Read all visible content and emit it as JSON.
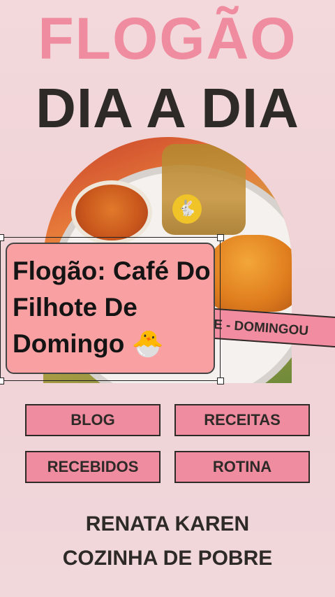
{
  "header": {
    "title_top": "FLOGÃO",
    "title_bottom": "DIA A DIA"
  },
  "photo": {
    "ribbon_text": "E - DOMINGOU",
    "cup_icon": "rabbit-icon"
  },
  "overlay": {
    "caption": "Flogão: Café Do Filhote De Domingo 🐣"
  },
  "buttons": {
    "blog": "BLOG",
    "receitas": "RECEITAS",
    "recebidos": "RECEBIDOS",
    "rotina": "ROTINA"
  },
  "footer": {
    "line1": "RENATA KAREN",
    "line2": "COZINHA DE POBRE"
  },
  "colors": {
    "background": "#f3d9dc",
    "accent_pink": "#f08ca0",
    "dark_text": "#2e2a28",
    "overlay_bg": "#f9a0a3"
  }
}
